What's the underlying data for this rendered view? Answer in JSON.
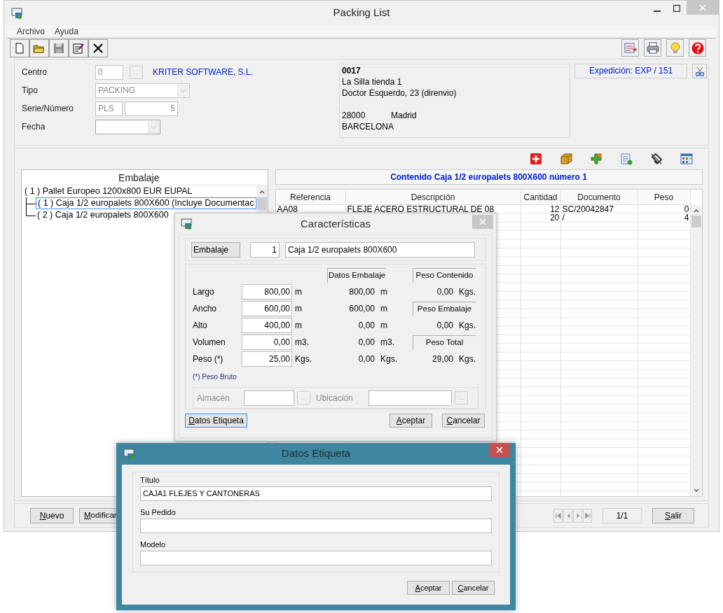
{
  "window": {
    "title": "Packing List"
  },
  "menu": [
    "Archivo",
    "Ayuda"
  ],
  "header": {
    "fields": [
      {
        "label": "Centro",
        "kind": "code",
        "value": "0",
        "disabled": true,
        "browse": "...",
        "extra": "KRITER SOFTWARE, S.L."
      },
      {
        "label": "Tipo",
        "kind": "combo",
        "value": "PACKING",
        "disabled": true
      },
      {
        "label": "Serie/Número",
        "kind": "pair",
        "value": "PLS",
        "value2": "5",
        "disabled": true
      },
      {
        "label": "Fecha",
        "kind": "combo",
        "disabled": false
      }
    ],
    "address": {
      "code": "0017",
      "lines": [
        "La Silla tienda 1",
        "Doctor Esquerdo, 23 (direnvio)"
      ],
      "postal": "28000",
      "city": "Madrid",
      "province": "BARCELONA"
    },
    "expedition": "Expedición: EXP / 151"
  },
  "tree": {
    "heading": "Embalaje",
    "items": [
      {
        "label": "( 1 ) Pallet Europeo 1200x800 EUR EUPAL",
        "selected": false,
        "children": [
          {
            "label": "( 1 ) Caja 1/2 europalets 800X600 (Incluye Documentac",
            "selected": true
          },
          {
            "label": "( 2 ) Caja 1/2 europalets 800X600",
            "selected": false
          }
        ]
      }
    ]
  },
  "content": {
    "title": "Contenido Caja 1/2 europalets 800X600 número 1",
    "columns": [
      "Referencia",
      "Descripción",
      "Cantidad",
      "Documento",
      "Peso"
    ],
    "rows": [
      [
        "AA08",
        "FLEJE ACERO ESTRUCTURAL DE 08",
        "12",
        "SC/20042847",
        "0"
      ],
      [
        null,
        null,
        "20",
        "/",
        "4"
      ]
    ]
  },
  "bottom": {
    "buttons": [
      "Nuevo",
      "Modificar"
    ],
    "pager": "1/1",
    "exit": "Salir"
  },
  "characteristics": {
    "title": "Características",
    "button": "Embalaje",
    "number": "1",
    "name": "Caja 1/2 europalets 800X600",
    "datos_heading": "Datos Embalaje",
    "rows": [
      {
        "label": "Largo",
        "value": "800,00",
        "unit": "m",
        "datos": "800,00",
        "datos_unit": "m"
      },
      {
        "label": "Ancho",
        "value": "600,00",
        "unit": "m",
        "datos": "600,00",
        "datos_unit": "m"
      },
      {
        "label": "Alto",
        "value": "400,00",
        "unit": "m",
        "datos": "0,00",
        "datos_unit": "m"
      },
      {
        "label": "Volumen",
        "value": "0,00",
        "unit": "m3.",
        "datos": "0,00",
        "datos_unit": "m3."
      },
      {
        "label": "Peso (*)",
        "value": "25,00",
        "unit": "Kgs.",
        "datos": "0,00",
        "datos_unit": "Kgs."
      }
    ],
    "right": [
      {
        "kind": "heading",
        "text": "Peso Contenido"
      },
      {
        "kind": "value",
        "text": "0,00",
        "unit": "Kgs."
      },
      {
        "kind": "heading",
        "text": "Peso Embalaje"
      },
      {
        "kind": "value",
        "text": "0,00",
        "unit": "Kgs."
      },
      {
        "kind": "heading",
        "text": "Peso Total"
      },
      {
        "kind": "value",
        "text": "29,00",
        "unit": "Kgs."
      }
    ],
    "note": "(*) Peso Bruto",
    "storage": [
      {
        "label": "Almacén",
        "disabled": true,
        "browse": "..."
      },
      {
        "label": "Ubicación",
        "disabled": true,
        "browse": "..."
      }
    ],
    "label_button": "Datos Etiqueta",
    "accept": "Aceptar",
    "cancel": "Cancelar"
  },
  "label_dialog": {
    "title": "Datos Etiqueta",
    "fields": [
      {
        "label": "Título",
        "value": "CAJA1 FLEJES Y CANTONERAS"
      },
      {
        "label": "Su Pedido"
      },
      {
        "label": "Modelo"
      }
    ],
    "accept": "Aceptar",
    "cancel": "Cancelar"
  }
}
